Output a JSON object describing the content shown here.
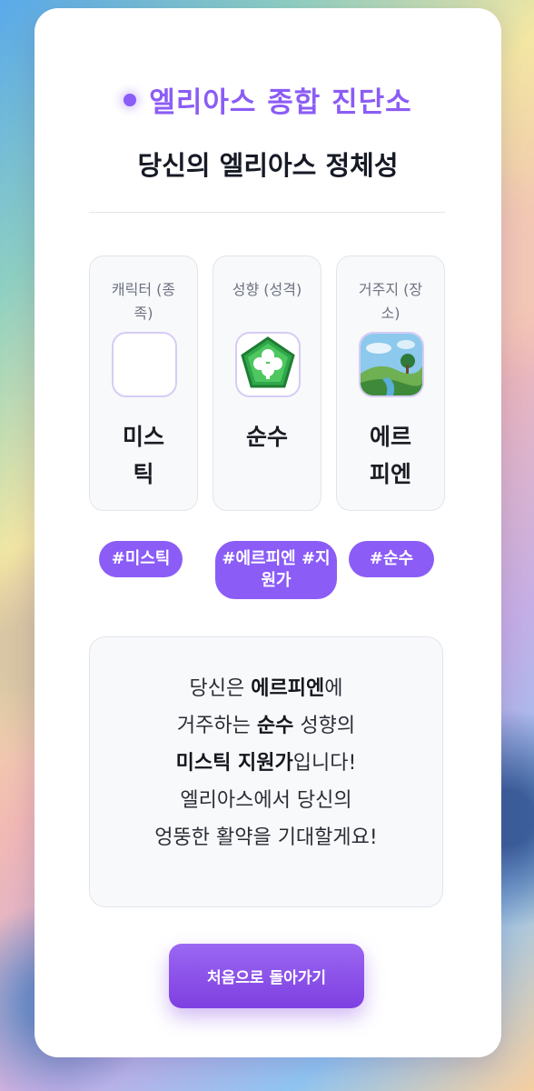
{
  "header": {
    "site_title": "엘리아스 종합 진단소",
    "page_title": "당신의 엘리아스 정체성"
  },
  "attributes": [
    {
      "label": "캐릭터 (종족)",
      "value": "미스틱",
      "icon": "empty-icon"
    },
    {
      "label": "성향 (성격)",
      "value": "순수",
      "icon": "clover-icon"
    },
    {
      "label": "거주지 (장소)",
      "value": "에르피엔",
      "icon": "landscape-icon"
    }
  ],
  "tags": [
    "#미스틱",
    "#에르피엔 #지원가",
    "#순수"
  ],
  "summary": {
    "line1_prefix": "당신은 ",
    "line1_bold": "에르피엔",
    "line1_suffix": "에",
    "line2_prefix": "거주하는 ",
    "line2_bold": "순수",
    "line2_suffix": " 성향의",
    "line3_bold": "미스틱 지원가",
    "line3_suffix": "입니다!",
    "line4": "엘리아스에서 당신의",
    "line5": "엉뚱한 활약을 기대할게요!"
  },
  "restart_button": "처음으로 돌아가기",
  "colors": {
    "accent": "#8b5cf6",
    "tag_bg": "#8b5cf6",
    "button": "#7e3fe0"
  }
}
